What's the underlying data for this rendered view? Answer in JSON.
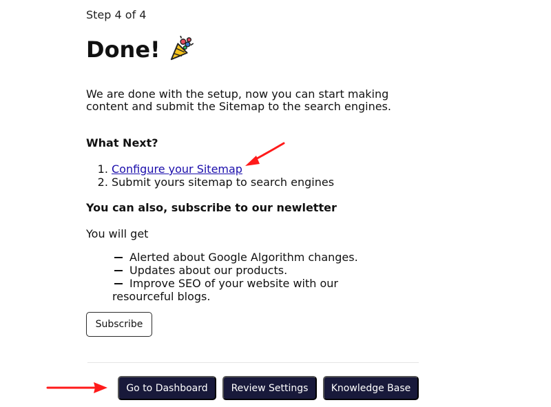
{
  "header": {
    "step_label": "Step 4 of 4",
    "title": "Done!",
    "title_icon": "party-popper-icon"
  },
  "intro": {
    "text": "We are done with the setup, now you can start making content and submit the Sitemap to the search engines."
  },
  "what_next": {
    "heading": "What Next?",
    "items": [
      {
        "label": "Configure your Sitemap",
        "is_link": true
      },
      {
        "label": "Submit yours sitemap to search engines",
        "is_link": false
      }
    ]
  },
  "newsletter": {
    "heading": "You can also, subscribe to our newletter",
    "lead": "You will get",
    "benefits": [
      "Alerted about Google Algorithm changes.",
      "Updates about our products.",
      "Improve SEO of your website with our resourceful blogs."
    ],
    "subscribe_label": "Subscribe"
  },
  "footer": {
    "buttons": [
      {
        "label": "Go to Dashboard"
      },
      {
        "label": "Review Settings"
      },
      {
        "label": "Knowledge Base"
      }
    ]
  },
  "colors": {
    "button_dark": "#18193a",
    "link": "#1a0dab",
    "annotation_arrow": "#ff1a1a"
  }
}
